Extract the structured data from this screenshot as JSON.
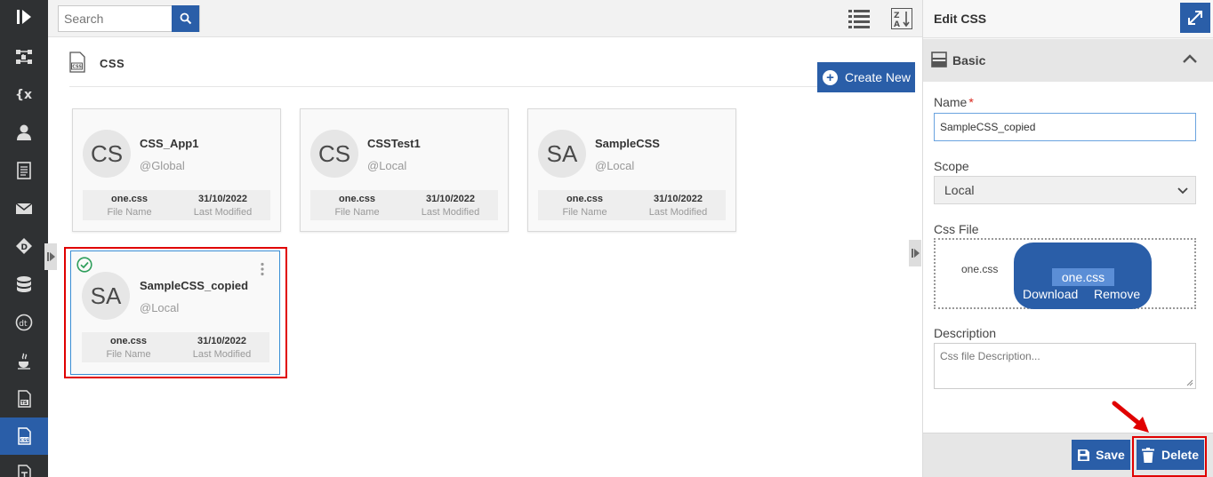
{
  "toolbar": {
    "search_placeholder": "Search"
  },
  "breadcrumb": {
    "title": "CSS"
  },
  "create_button": "Create New",
  "cards": [
    {
      "initials": "CS",
      "name": "CSS_App1",
      "scope": "@Global",
      "file": "one.css",
      "file_label": "File Name",
      "date": "31/10/2022",
      "date_label": "Last Modified"
    },
    {
      "initials": "CS",
      "name": "CSSTest1",
      "scope": "@Local",
      "file": "one.css",
      "file_label": "File Name",
      "date": "31/10/2022",
      "date_label": "Last Modified"
    },
    {
      "initials": "SA",
      "name": "SampleCSS",
      "scope": "@Local",
      "file": "one.css",
      "file_label": "File Name",
      "date": "31/10/2022",
      "date_label": "Last Modified"
    },
    {
      "initials": "SA",
      "name": "SampleCSS_copied",
      "scope": "@Local",
      "file": "one.css",
      "file_label": "File Name",
      "date": "31/10/2022",
      "date_label": "Last Modified"
    }
  ],
  "panel": {
    "title": "Edit CSS",
    "section_title": "Basic",
    "name_label": "Name",
    "required_mark": "*",
    "name_value": "SampleCSS_copied",
    "scope_label": "Scope",
    "scope_value": "Local",
    "css_file_label": "Css File",
    "css_file_name": "one.css",
    "chip_label": "one.css",
    "download_label": "Download",
    "remove_label": "Remove",
    "description_label": "Description",
    "description_placeholder": "Css file Description...",
    "save_label": "Save",
    "delete_label": "Delete"
  },
  "colors": {
    "primary": "#2a5ea8",
    "rail": "#2f3133",
    "highlight": "#e00000",
    "check": "#2e9e5b"
  },
  "rail_icons": [
    "play-logo-icon",
    "workflow-icon",
    "variable-icon",
    "user-icon",
    "document-icon",
    "mail-icon",
    "diamond-d-icon",
    "database-icon",
    "dt-icon",
    "java-icon",
    "ts-file-icon",
    "css-file-icon",
    "text-file-icon"
  ]
}
